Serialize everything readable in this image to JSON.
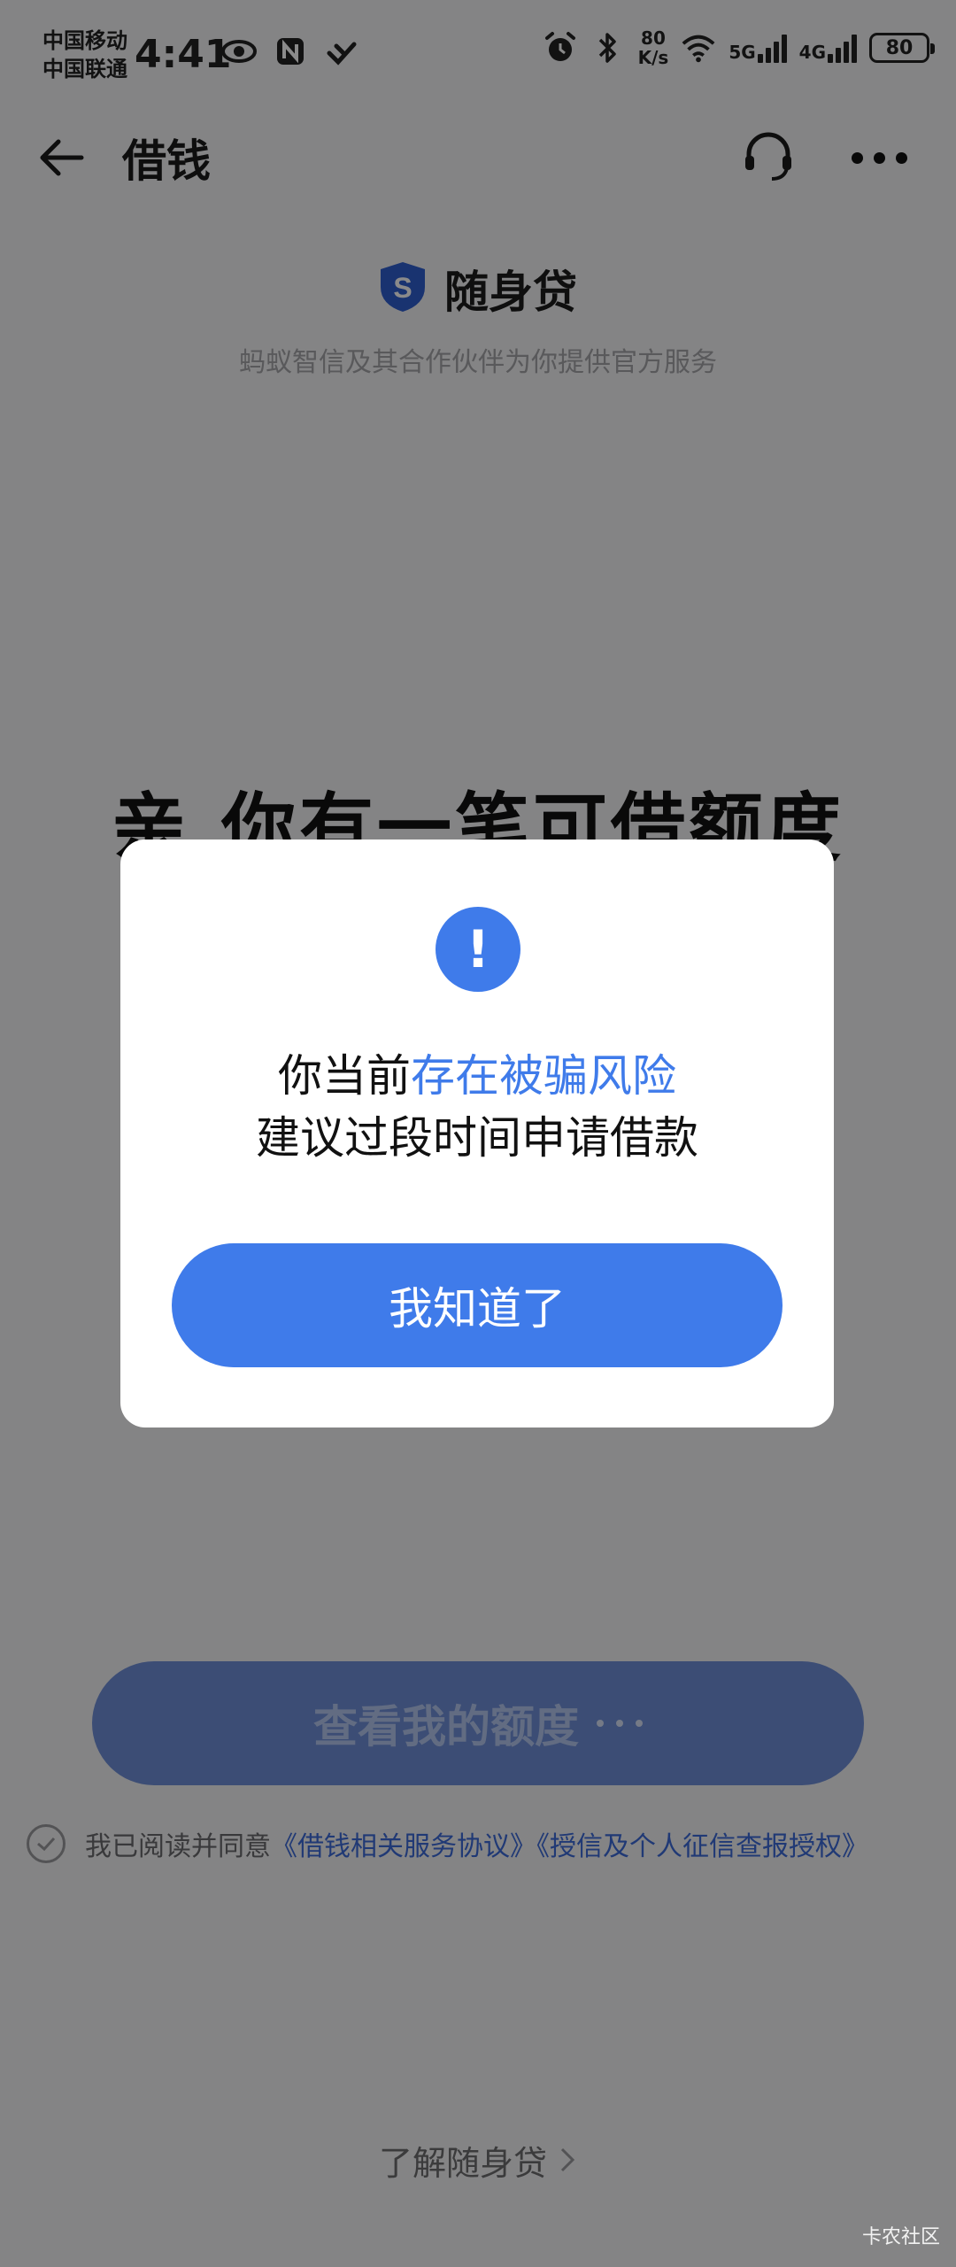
{
  "status_bar": {
    "carrier_1": "中国移动",
    "carrier_2": "中国联通",
    "time": "4:41",
    "net_speed_value": "80",
    "net_speed_unit": "K/s",
    "signal_1": "5G",
    "signal_2": "4G",
    "battery": "80"
  },
  "nav": {
    "title": "借钱",
    "icons": [
      "back-arrow-icon",
      "headset-support-icon",
      "more-options-icon"
    ]
  },
  "brand": {
    "logo_letter": "S",
    "name": "随身贷",
    "subtitle": "蚂蚁智信及其合作伙伴为你提供官方服务"
  },
  "headline": "亲,你有一笔可借额度",
  "cta": {
    "label": "查看我的额度"
  },
  "agreement": {
    "prefix": "我已阅读并同意",
    "link_1": "《借钱相关服务协议》",
    "link_2": "《授信及个人征信查报授权》"
  },
  "learn_more": {
    "label": "了解随身贷",
    "icon": "chevron-right-icon"
  },
  "watermark": "卡农社区",
  "dialog": {
    "icon": "!",
    "line1_prefix": "你当前",
    "line1_highlight": "存在被骗风险",
    "line2": "建议过段时间申请借款",
    "button": "我知道了"
  },
  "colors": {
    "accent": "#3f7bea",
    "link": "#3c6ad8",
    "mask": "rgba(0,0,0,0.46)"
  }
}
